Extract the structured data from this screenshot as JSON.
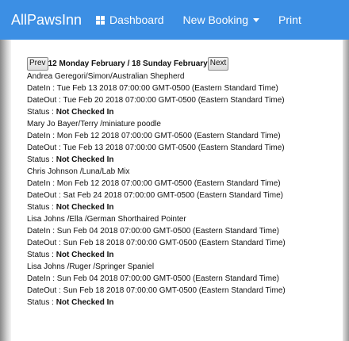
{
  "nav": {
    "brand": "AllPawsInn",
    "dashboard_label": "Dashboard",
    "dashboard_icon": "grid-icon",
    "new_booking_label": "New Booking",
    "new_booking_icon": "caret-down-icon",
    "print_label": "Print",
    "background_color": "#3c8fe4"
  },
  "pager": {
    "prev_label": "Prev",
    "range_label": "12 Monday February / 18 Sunday February",
    "next_label": "Next"
  },
  "bookings": [
    {
      "title": "Andrea Geregori/Simon/Australian Shepherd",
      "date_in": "DateIn : Tue Feb 13 2018 07:00:00 GMT-0500 (Eastern Standard Time)",
      "date_out": "DateOut : Tue Feb 20 2018 07:00:00 GMT-0500 (Eastern Standard Time)",
      "status_label": "Status : ",
      "status_value": "Not Checked In"
    },
    {
      "title": "Mary Jo Bayer/Terry /miniature poodle",
      "date_in": "DateIn : Mon Feb 12 2018 07:00:00 GMT-0500 (Eastern Standard Time)",
      "date_out": "DateOut : Tue Feb 13 2018 07:00:00 GMT-0500 (Eastern Standard Time)",
      "status_label": "Status : ",
      "status_value": "Not Checked In"
    },
    {
      "title": "Chris Johnson /Luna/Lab Mix",
      "date_in": "DateIn : Mon Feb 12 2018 07:00:00 GMT-0500 (Eastern Standard Time)",
      "date_out": "DateOut : Sat Feb 24 2018 07:00:00 GMT-0500 (Eastern Standard Time)",
      "status_label": "Status : ",
      "status_value": "Not Checked In"
    },
    {
      "title": "Lisa Johns /Ella /German Shorthaired Pointer",
      "date_in": "DateIn : Sun Feb 04 2018 07:00:00 GMT-0500 (Eastern Standard Time)",
      "date_out": "DateOut : Sun Feb 18 2018 07:00:00 GMT-0500 (Eastern Standard Time)",
      "status_label": "Status : ",
      "status_value": "Not Checked In"
    },
    {
      "title": "Lisa Johns /Ruger /Springer Spaniel",
      "date_in": "DateIn : Sun Feb 04 2018 07:00:00 GMT-0500 (Eastern Standard Time)",
      "date_out": "DateOut : Sun Feb 18 2018 07:00:00 GMT-0500 (Eastern Standard Time)",
      "status_label": "Status : ",
      "status_value": "Not Checked In"
    }
  ]
}
